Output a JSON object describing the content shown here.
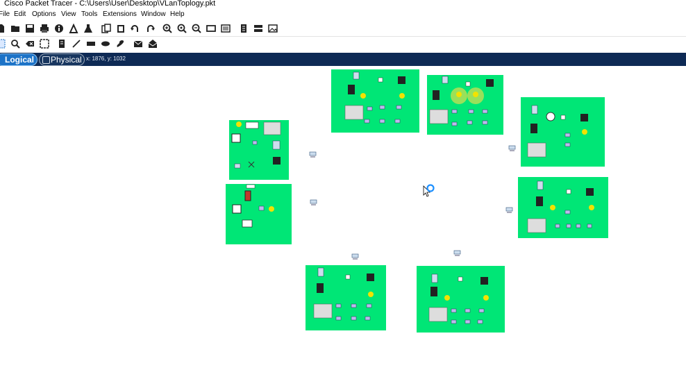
{
  "window": {
    "title": "Cisco Packet Tracer - C:\\Users\\User\\Desktop\\VLanToplogy.pkt"
  },
  "menu": [
    "File",
    "Edit",
    "Options",
    "View",
    "Tools",
    "Extensions",
    "Window",
    "Help"
  ],
  "toolbar_main": [
    "new-icon",
    "open-icon",
    "save-icon",
    "print-icon",
    "info-icon",
    "network-wizard-icon",
    "custom-icon",
    "copy-icon",
    "paste-icon",
    "undo-icon",
    "redo-icon",
    "zoom-in-icon",
    "zoom-reset-icon",
    "zoom-out-icon",
    "drawing-palette-icon",
    "custom-device-dialog-icon",
    "list-icon",
    "cluster-view-icon",
    "image-icon"
  ],
  "toolbar_tools": [
    "select-icon",
    "inspect-icon",
    "delete-icon",
    "resize-icon",
    "note-icon",
    "line-icon",
    "rectangle-icon",
    "ellipse-icon",
    "freeform-icon",
    "add-simple-pdu-icon",
    "add-complex-pdu-icon"
  ],
  "mode_bar": {
    "logical_label": "Logical",
    "physical_label": "Physical",
    "coords": "x: 1876, y: 1032"
  },
  "colors": {
    "cluster": "#00e676",
    "modebar": "#0e2a55",
    "logical_tab": "#1d73c7"
  }
}
